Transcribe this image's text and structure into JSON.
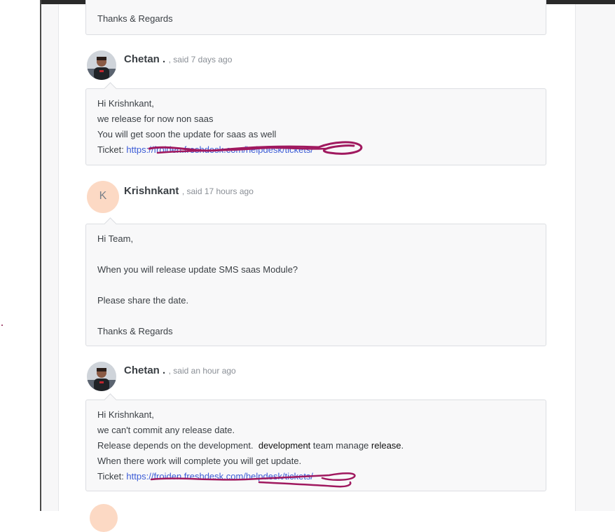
{
  "thread": {
    "prev_closing": "Thanks & Regards",
    "comments": [
      {
        "author": "Chetan .",
        "said": ", said 7 days ago",
        "lines": [
          "Hi Krishnkant,",
          "we release for now non saas",
          "You will get soon the update for saas as well"
        ],
        "ticket_prefix": "Ticket: ",
        "ticket_link": "https://froiden.freshdesk.com/helpdesk/tickets/"
      },
      {
        "author": "Krishnkant",
        "avatar_initial": "K",
        "said": ", said 17 hours ago",
        "lines": [
          "Hi Team,",
          "",
          "When you will release update SMS saas Module?",
          "",
          "Please share the date.",
          "",
          "Thanks & Regards"
        ]
      },
      {
        "author": "Chetan .",
        "said": ", said an hour ago",
        "lines": [
          "Hi Krishnkant,",
          "we can't commit any release date.",
          "Release depends on the development.",
          "When there work will complete you will get update."
        ],
        "line3_extra_a": "development",
        "line3_extra_b": " team manage ",
        "line3_extra_c": "release",
        "ticket_prefix": "Ticket: ",
        "ticket_link": "https://froiden.freshdesk.com/helpdesk/tickets/"
      }
    ]
  },
  "colors": {
    "link": "#3b5bd6",
    "scribble": "#a0195f",
    "avatar_initial_bg": "#fcd9c4"
  }
}
